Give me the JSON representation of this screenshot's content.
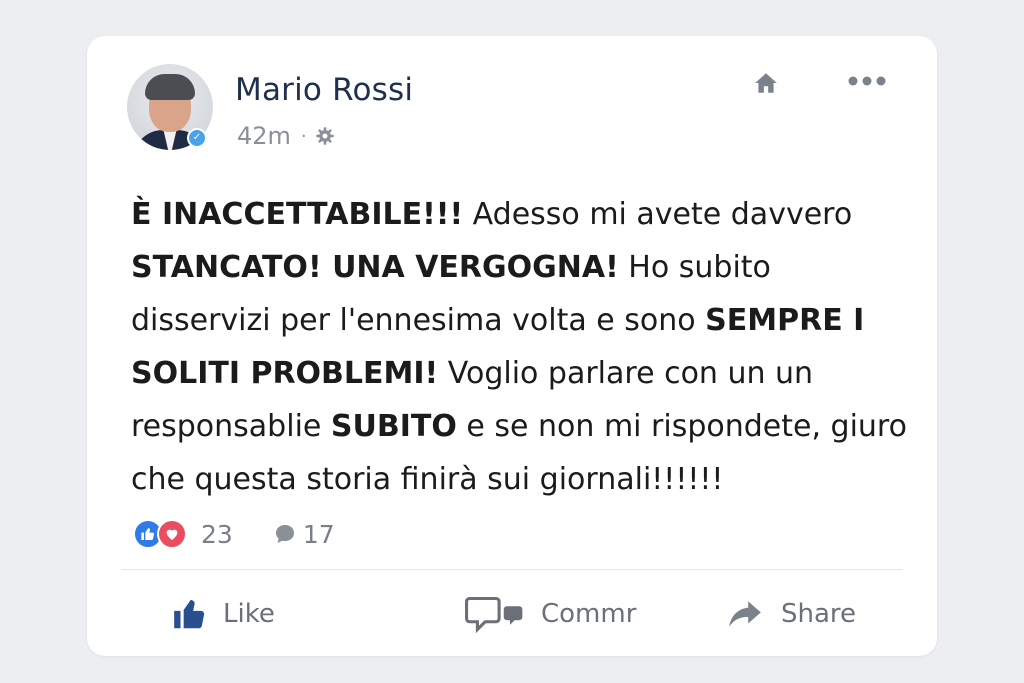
{
  "post": {
    "author": "Mario Rossi",
    "time": "42m",
    "meta_separator": "·",
    "verified_badge": "✓",
    "text_segments": [
      {
        "bold": true,
        "text": "È INACCETTABILE!!!"
      },
      {
        "bold": false,
        "text": " Adesso mi avete davvero "
      },
      {
        "bold": true,
        "text": "STANCATO! UNA VERGOGNA!"
      },
      {
        "bold": false,
        "text": " Ho subito disservizi per l'ennesima volta e sono "
      },
      {
        "bold": true,
        "text": "SEMPRE I SOLITI PROBLEMI!"
      },
      {
        "bold": false,
        "text": " Voglio parlare con un un responsablie "
      },
      {
        "bold": true,
        "text": "SUBITO"
      },
      {
        "bold": false,
        "text": " e se non mi rispondete, giuro che questa storia finirà sui giornali!!!!!!"
      }
    ],
    "reactions_count": "23",
    "comments_count": "17"
  },
  "actions": {
    "like_label": "Like",
    "comment_label": "Commr",
    "share_label": "Share"
  },
  "icons": {
    "privacy": "gear-icon",
    "home": "home-icon",
    "more": "more-icon",
    "like_reaction": "thumbs-up-icon",
    "love_reaction": "heart-icon",
    "comments": "comment-bubble-icon",
    "like_action": "thumbs-up-icon",
    "comment_action": "comment-icon",
    "share_action": "share-arrow-icon"
  },
  "colors": {
    "author": "#1f2f4e",
    "like_blue": "#2f7be8",
    "love_red": "#ea4d5f",
    "verified": "#4aa3ea",
    "muted": "#7a7f87"
  }
}
